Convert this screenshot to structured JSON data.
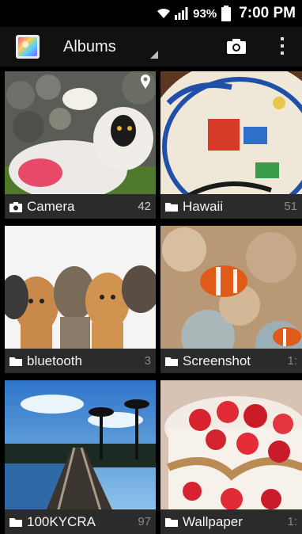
{
  "status_bar": {
    "battery": "93%",
    "time": "7:00 PM",
    "icons": [
      "wifi-icon",
      "signal-icon",
      "battery-icon"
    ]
  },
  "action_bar": {
    "title": "Albums",
    "icons": [
      "app-gallery-icon",
      "camera-icon",
      "overflow-menu-icon"
    ]
  },
  "albums": [
    {
      "name": "Camera",
      "count": "42",
      "icon": "camera-icon"
    },
    {
      "name": "Hawaii",
      "count": "51",
      "icon": "folder-icon"
    },
    {
      "name": "bluetooth",
      "count": "3",
      "icon": "folder-icon"
    },
    {
      "name": "Screenshot",
      "count": "1:",
      "icon": "folder-icon"
    },
    {
      "name": "100KYCRA",
      "count": "97",
      "icon": "folder-icon"
    },
    {
      "name": "Wallpaper",
      "count": "1:",
      "icon": "folder-icon"
    }
  ],
  "colors": {
    "background": "#000000",
    "action_bar": "#111111",
    "label_bar": "#2b2b2b"
  }
}
